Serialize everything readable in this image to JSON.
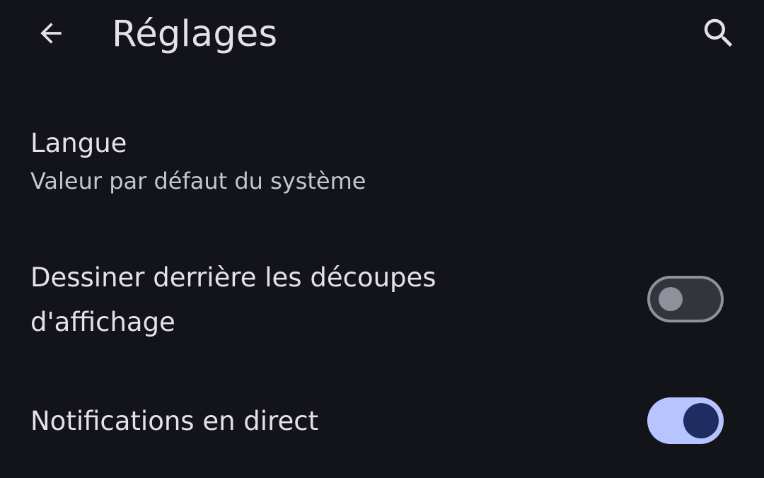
{
  "app_bar": {
    "back_icon": "arrow-back-icon",
    "title": "Réglages",
    "search_icon": "search-icon"
  },
  "preferences": [
    {
      "title": "Langue",
      "summary": "Valeur par défaut du système"
    },
    {
      "title_line1": "Dessiner derrière les découpes",
      "title_line2": "d'affichage",
      "switch_on": false
    },
    {
      "title": "Notifications en direct",
      "switch_on": true
    }
  ],
  "colors": {
    "background": "#13141a",
    "on_surface": "#e4e2e9",
    "on_surface_variant": "#c5c5d0",
    "switch_on_track": "#b7c4ff",
    "switch_on_thumb": "#1f2c61",
    "switch_off_track": "#33343c",
    "switch_off_outline": "#8f909a"
  }
}
